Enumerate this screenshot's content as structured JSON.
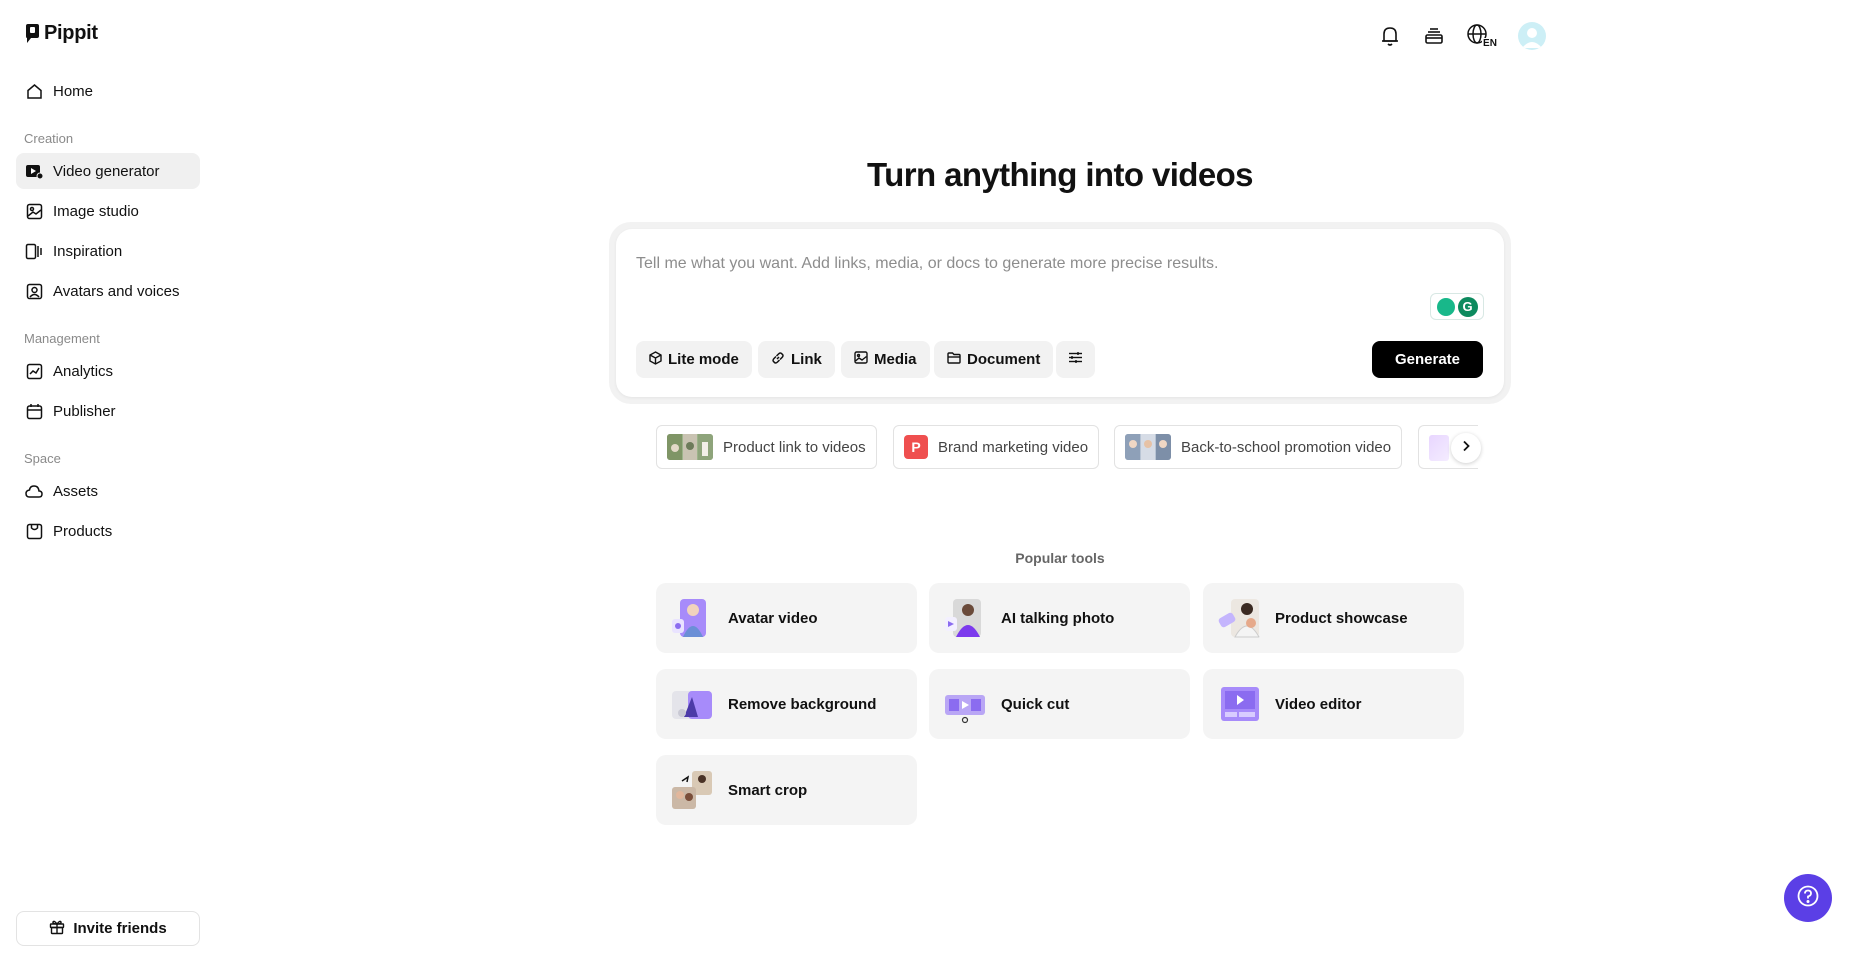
{
  "app": {
    "name": "Pippit"
  },
  "sidebar": {
    "home": "Home",
    "sections": {
      "creation": "Creation",
      "management": "Management",
      "space": "Space"
    },
    "creation_items": [
      "Video generator",
      "Image studio",
      "Inspiration",
      "Avatars and voices"
    ],
    "management_items": [
      "Analytics",
      "Publisher"
    ],
    "space_items": [
      "Assets",
      "Products"
    ],
    "invite": "Invite friends"
  },
  "header": {
    "language": "EN"
  },
  "main": {
    "title": "Turn anything into videos",
    "prompt_placeholder": "Tell me what you want. Add links, media, or docs to generate more precise results.",
    "chips": [
      "Lite mode",
      "Link",
      "Media",
      "Document"
    ],
    "generate": "Generate",
    "grammarly_letter": "G",
    "suggestions": [
      "Product link to videos",
      "Brand marketing video",
      "Back-to-school promotion video"
    ],
    "brand_letter": "P",
    "popular_label": "Popular tools",
    "tools": [
      "Avatar video",
      "AI talking photo",
      "Product showcase",
      "Remove background",
      "Quick cut",
      "Video editor",
      "Smart crop"
    ]
  },
  "colors": {
    "accent": "#5b3fe6",
    "generate_bg": "#000000",
    "active_nav_bg": "#f0f0f0"
  }
}
